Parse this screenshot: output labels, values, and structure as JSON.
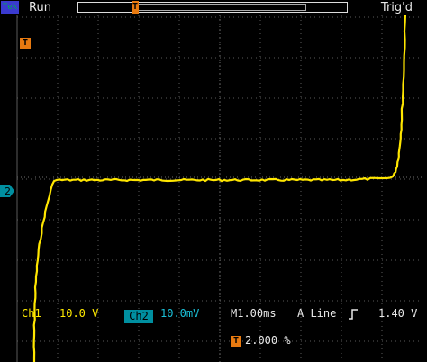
{
  "status": {
    "brand": "Tek",
    "run_state": "Run",
    "trigger_state": "Trig'd"
  },
  "markers": {
    "trigger_position": "T",
    "channel_ground": "2"
  },
  "readouts": {
    "ch1_label": "Ch1",
    "ch1_scale": "10.0 V",
    "ch2_label": "Ch2",
    "ch2_scale": "10.0mV",
    "timebase": "M1.00ms",
    "trigger_source": "A Line",
    "trigger_slope_icon": "rising-edge-icon",
    "trigger_level": "1.40 V",
    "trigger_offset_marker": "T",
    "trigger_offset": "2.000 %"
  },
  "colors": {
    "trace": "#ffe600",
    "grid": "#5a5a5a",
    "ch2": "#008fa0",
    "marker": "#e87a10",
    "text": "#e8e8e8"
  }
}
